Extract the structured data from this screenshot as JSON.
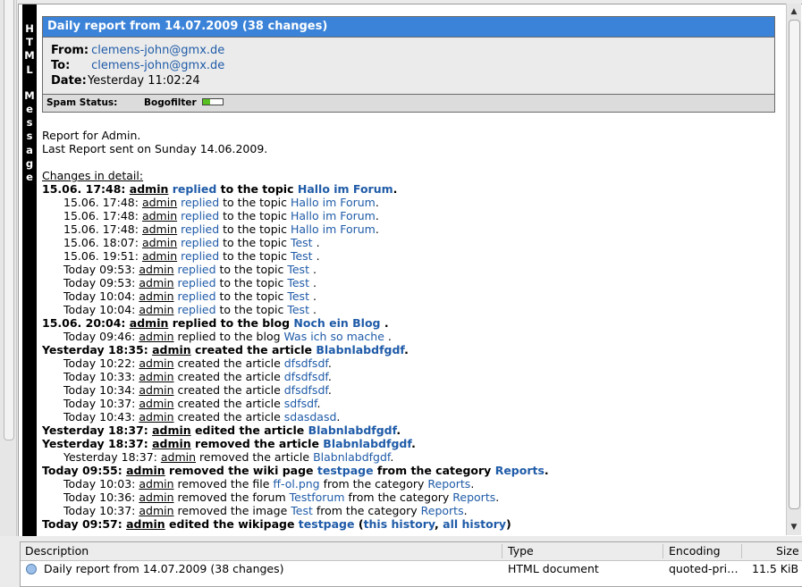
{
  "strip": {
    "letters": [
      "H",
      "T",
      "M",
      "L",
      "",
      "M",
      "e",
      "s",
      "s",
      "a",
      "g",
      "e"
    ]
  },
  "header": {
    "title": "Daily report from 14.07.2009 (38 changes)",
    "from_label": "From:",
    "from_value": "clemens-john@gmx.de",
    "to_label": "To:",
    "to_value": "clemens-john@gmx.de",
    "date_label": "Date:",
    "date_value": "Yesterday 11:02:24",
    "spam_label": "Spam Status:",
    "bogofilter_label": "Bogofilter",
    "spam_level": 0.35,
    "colors": {
      "title_bg": "#3b83d8",
      "link": "#1f5ba8",
      "meter": "#58c020"
    }
  },
  "body": {
    "intro1": "Report for Admin.",
    "intro2": "Last Report sent on Sunday 14.06.2009.",
    "changes_heading": "Changes in detail:",
    "lines": [
      {
        "style": "bold",
        "parts": [
          {
            "t": "15.06. 17:48: "
          },
          {
            "t": "admin",
            "u": 1
          },
          {
            "t": " "
          },
          {
            "t": "replied",
            "l": 1
          },
          {
            "t": " to the topic "
          },
          {
            "t": "Hallo im Forum",
            "l": 1
          },
          {
            "t": "."
          }
        ]
      },
      {
        "style": "indent",
        "parts": [
          {
            "t": "15.06. 17:48: "
          },
          {
            "t": "admin",
            "u": 1
          },
          {
            "t": " "
          },
          {
            "t": "replied",
            "l": 1
          },
          {
            "t": " to the topic "
          },
          {
            "t": "Hallo im Forum",
            "l": 1
          },
          {
            "t": "."
          }
        ]
      },
      {
        "style": "indent",
        "parts": [
          {
            "t": "15.06. 17:48: "
          },
          {
            "t": "admin",
            "u": 1
          },
          {
            "t": " "
          },
          {
            "t": "replied",
            "l": 1
          },
          {
            "t": " to the topic "
          },
          {
            "t": "Hallo im Forum",
            "l": 1
          },
          {
            "t": "."
          }
        ]
      },
      {
        "style": "indent",
        "parts": [
          {
            "t": "15.06. 17:48: "
          },
          {
            "t": "admin",
            "u": 1
          },
          {
            "t": " "
          },
          {
            "t": "replied",
            "l": 1
          },
          {
            "t": " to the topic "
          },
          {
            "t": "Hallo im Forum",
            "l": 1
          },
          {
            "t": "."
          }
        ]
      },
      {
        "style": "indent",
        "parts": [
          {
            "t": "15.06. 18:07: "
          },
          {
            "t": "admin",
            "u": 1
          },
          {
            "t": " "
          },
          {
            "t": "replied",
            "l": 1
          },
          {
            "t": " to the topic "
          },
          {
            "t": "Test",
            "l": 1
          },
          {
            "t": " ."
          }
        ]
      },
      {
        "style": "indent",
        "parts": [
          {
            "t": "15.06. 19:51: "
          },
          {
            "t": "admin",
            "u": 1
          },
          {
            "t": " "
          },
          {
            "t": "replied",
            "l": 1
          },
          {
            "t": " to the topic "
          },
          {
            "t": "Test",
            "l": 1
          },
          {
            "t": " ."
          }
        ]
      },
      {
        "style": "indent",
        "parts": [
          {
            "t": "Today 09:53: "
          },
          {
            "t": "admin",
            "u": 1
          },
          {
            "t": " "
          },
          {
            "t": "replied",
            "l": 1
          },
          {
            "t": " to the topic "
          },
          {
            "t": "Test",
            "l": 1
          },
          {
            "t": " ."
          }
        ]
      },
      {
        "style": "indent",
        "parts": [
          {
            "t": "Today 09:53: "
          },
          {
            "t": "admin",
            "u": 1
          },
          {
            "t": " "
          },
          {
            "t": "replied",
            "l": 1
          },
          {
            "t": " to the topic "
          },
          {
            "t": "Test",
            "l": 1
          },
          {
            "t": " ."
          }
        ]
      },
      {
        "style": "indent",
        "parts": [
          {
            "t": "Today 10:04: "
          },
          {
            "t": "admin",
            "u": 1
          },
          {
            "t": " "
          },
          {
            "t": "replied",
            "l": 1
          },
          {
            "t": " to the topic "
          },
          {
            "t": "Test",
            "l": 1
          },
          {
            "t": " ."
          }
        ]
      },
      {
        "style": "indent",
        "parts": [
          {
            "t": "Today 10:04: "
          },
          {
            "t": "admin",
            "u": 1
          },
          {
            "t": " "
          },
          {
            "t": "replied",
            "l": 1
          },
          {
            "t": " to the topic "
          },
          {
            "t": "Test",
            "l": 1
          },
          {
            "t": " ."
          }
        ]
      },
      {
        "style": "bold",
        "parts": [
          {
            "t": "15.06. 20:04: "
          },
          {
            "t": "admin",
            "u": 1
          },
          {
            "t": " replied to the blog "
          },
          {
            "t": "Noch ein Blog",
            "l": 1
          },
          {
            "t": " ."
          }
        ]
      },
      {
        "style": "indent",
        "parts": [
          {
            "t": "Today 09:46: "
          },
          {
            "t": "admin",
            "u": 1
          },
          {
            "t": " replied to the blog "
          },
          {
            "t": "Was ich so mache",
            "l": 1
          },
          {
            "t": " ."
          }
        ]
      },
      {
        "style": "bold",
        "parts": [
          {
            "t": "Yesterday 18:35: "
          },
          {
            "t": "admin",
            "u": 1
          },
          {
            "t": " created the article "
          },
          {
            "t": "Blabnlabdfgdf",
            "l": 1
          },
          {
            "t": "."
          }
        ]
      },
      {
        "style": "indent",
        "parts": [
          {
            "t": "Today 10:22: "
          },
          {
            "t": "admin",
            "u": 1
          },
          {
            "t": " created the article "
          },
          {
            "t": "dfsdfsdf",
            "l": 1
          },
          {
            "t": "."
          }
        ]
      },
      {
        "style": "indent",
        "parts": [
          {
            "t": "Today 10:33: "
          },
          {
            "t": "admin",
            "u": 1
          },
          {
            "t": " created the article "
          },
          {
            "t": "dfsdfsdf",
            "l": 1
          },
          {
            "t": "."
          }
        ]
      },
      {
        "style": "indent",
        "parts": [
          {
            "t": "Today 10:34: "
          },
          {
            "t": "admin",
            "u": 1
          },
          {
            "t": " created the article "
          },
          {
            "t": "dfsdfsdf",
            "l": 1
          },
          {
            "t": "."
          }
        ]
      },
      {
        "style": "indent",
        "parts": [
          {
            "t": "Today 10:37: "
          },
          {
            "t": "admin",
            "u": 1
          },
          {
            "t": " created the article "
          },
          {
            "t": "sdfsdf",
            "l": 1
          },
          {
            "t": "."
          }
        ]
      },
      {
        "style": "indent",
        "parts": [
          {
            "t": "Today 10:43: "
          },
          {
            "t": "admin",
            "u": 1
          },
          {
            "t": " created the article "
          },
          {
            "t": "sdasdasd",
            "l": 1
          },
          {
            "t": "."
          }
        ]
      },
      {
        "style": "bold",
        "parts": [
          {
            "t": "Yesterday 18:37: "
          },
          {
            "t": "admin",
            "u": 1
          },
          {
            "t": " edited the article "
          },
          {
            "t": "Blabnlabdfgdf",
            "l": 1
          },
          {
            "t": "."
          }
        ]
      },
      {
        "style": "bold",
        "parts": [
          {
            "t": "Yesterday 18:37: "
          },
          {
            "t": "admin",
            "u": 1
          },
          {
            "t": " removed the article "
          },
          {
            "t": "Blabnlabdfgdf",
            "l": 1
          },
          {
            "t": "."
          }
        ]
      },
      {
        "style": "indent",
        "parts": [
          {
            "t": "Yesterday 18:37: "
          },
          {
            "t": "admin",
            "u": 1
          },
          {
            "t": " removed the article "
          },
          {
            "t": "Blabnlabdfgdf",
            "l": 1
          },
          {
            "t": "."
          }
        ]
      },
      {
        "style": "bold",
        "parts": [
          {
            "t": "Today 09:55: "
          },
          {
            "t": "admin",
            "u": 1
          },
          {
            "t": " removed the wiki page "
          },
          {
            "t": "testpage",
            "l": 1
          },
          {
            "t": " from the category "
          },
          {
            "t": "Reports",
            "l": 1
          },
          {
            "t": "."
          }
        ]
      },
      {
        "style": "indent",
        "parts": [
          {
            "t": "Today 10:03: "
          },
          {
            "t": "admin",
            "u": 1
          },
          {
            "t": " removed the file "
          },
          {
            "t": "ff-ol.png",
            "l": 1
          },
          {
            "t": " from the category "
          },
          {
            "t": "Reports",
            "l": 1
          },
          {
            "t": "."
          }
        ]
      },
      {
        "style": "indent",
        "parts": [
          {
            "t": "Today 10:36: "
          },
          {
            "t": "admin",
            "u": 1
          },
          {
            "t": " removed the forum "
          },
          {
            "t": "Testforum",
            "l": 1
          },
          {
            "t": " from the category "
          },
          {
            "t": "Reports",
            "l": 1
          },
          {
            "t": "."
          }
        ]
      },
      {
        "style": "indent",
        "parts": [
          {
            "t": "Today 10:37: "
          },
          {
            "t": "admin",
            "u": 1
          },
          {
            "t": " removed the image "
          },
          {
            "t": "Test",
            "l": 1
          },
          {
            "t": " from the category "
          },
          {
            "t": "Reports",
            "l": 1
          },
          {
            "t": "."
          }
        ]
      },
      {
        "style": "bold",
        "parts": [
          {
            "t": "Today 09:57: "
          },
          {
            "t": "admin",
            "u": 1
          },
          {
            "t": " edited the wikipage "
          },
          {
            "t": "testpage",
            "l": 1
          },
          {
            "t": " ("
          },
          {
            "t": "this history",
            "l": 1
          },
          {
            "t": ", "
          },
          {
            "t": "all history",
            "l": 1
          },
          {
            "t": ")"
          }
        ]
      }
    ]
  },
  "attachments": {
    "columns": {
      "description": "Description",
      "type": "Type",
      "encoding": "Encoding",
      "size": "Size"
    },
    "rows": [
      {
        "icon": "html-document-icon",
        "description": "Daily report from 14.07.2009 (38 changes)",
        "type": "HTML document",
        "encoding": "quoted-pri…",
        "size": "11.5 KiB"
      }
    ]
  }
}
